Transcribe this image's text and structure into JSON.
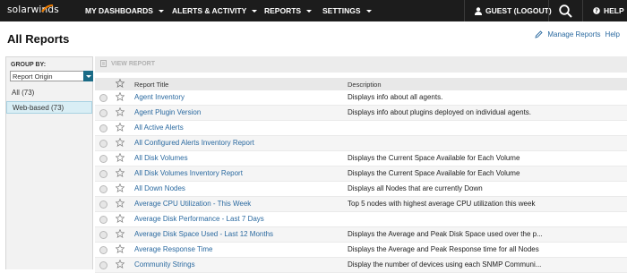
{
  "brand": {
    "logo_text": "solarwinds"
  },
  "nav": {
    "items": [
      {
        "label": "MY DASHBOARDS"
      },
      {
        "label": "ALERTS & ACTIVITY"
      },
      {
        "label": "REPORTS"
      },
      {
        "label": "SETTINGS"
      }
    ],
    "user_label": "GUEST (LOGOUT)",
    "help_label": "HELP"
  },
  "page": {
    "title": "All Reports",
    "manage_label": "Manage Reports",
    "help_label": "Help"
  },
  "left": {
    "groupby_label": "GROUP BY:",
    "groupby_value": "Report Origin",
    "groups": [
      {
        "label": "All (73)"
      },
      {
        "label": "Web-based (73)"
      }
    ]
  },
  "toolbar": {
    "view_report_label": "VIEW REPORT"
  },
  "table": {
    "headers": {
      "title": "Report Title",
      "description": "Description"
    },
    "rows": [
      {
        "title": "Agent Inventory",
        "description": "Displays info about all agents."
      },
      {
        "title": "Agent Plugin Version",
        "description": "Displays info about plugins deployed on individual agents."
      },
      {
        "title": "All Active Alerts",
        "description": ""
      },
      {
        "title": "All Configured Alerts Inventory Report",
        "description": ""
      },
      {
        "title": "All Disk Volumes",
        "description": "Displays the Current Space Available for Each Volume"
      },
      {
        "title": "All Disk Volumes Inventory Report",
        "description": "Displays the Current Space Available for Each Volume"
      },
      {
        "title": "All Down Nodes",
        "description": "Displays all Nodes that are currently Down"
      },
      {
        "title": "Average CPU Utilization - This Week",
        "description": "Top 5 nodes with highest average CPU utilization this week"
      },
      {
        "title": "Average Disk Performance - Last 7 Days",
        "description": ""
      },
      {
        "title": "Average Disk Space Used - Last 12 Months",
        "description": "Displays the Average and Peak Disk Space used over the p..."
      },
      {
        "title": "Average Response Time",
        "description": "Displays the Average and Peak Response time for all Nodes"
      },
      {
        "title": "Community Strings",
        "description": "Display the number of devices using each SNMP Communi..."
      }
    ]
  },
  "colors": {
    "nav_bg": "#1c1c1c",
    "link": "#2b6aa0",
    "select_button": "#1a6b86",
    "selected_group_bg": "#d9eef5"
  }
}
